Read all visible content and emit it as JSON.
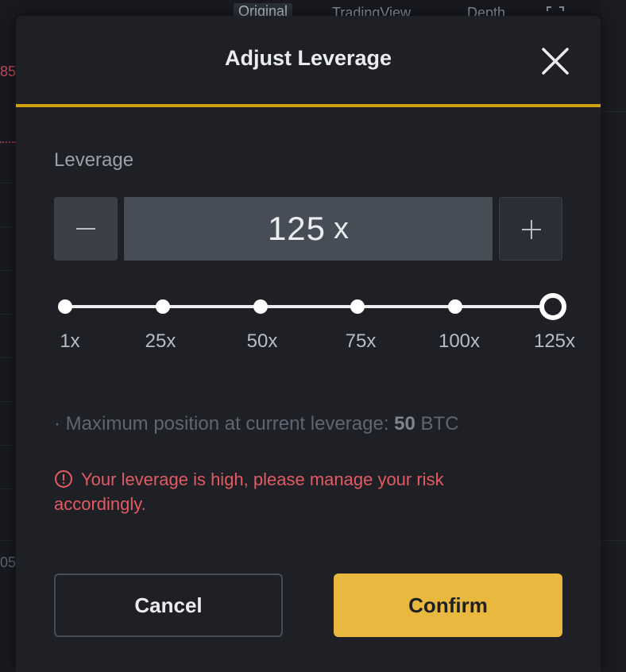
{
  "background": {
    "tabs": [
      "Original",
      "TradingView",
      "Depth"
    ],
    "price_top": "85",
    "price_bottom": "05"
  },
  "modal": {
    "title": "Adjust Leverage",
    "leverage_label": "Leverage",
    "leverage_value": "125",
    "leverage_unit": "x",
    "slider": {
      "marks": [
        "1x",
        "25x",
        "50x",
        "75x",
        "100x",
        "125x"
      ],
      "selected_index": 5
    },
    "max_position": {
      "prefix": "· Maximum position at current leverage: ",
      "amount": "50",
      "unit": " BTC"
    },
    "warning": "Your leverage is high, please manage your risk accordingly.",
    "cancel_label": "Cancel",
    "confirm_label": "Confirm"
  },
  "colors": {
    "accent": "#f0b90b",
    "confirm": "#e8b93e",
    "warning": "#e35a63",
    "modal_bg": "#1e2026"
  },
  "icons": {
    "close": "close-icon",
    "minus": "minus-icon",
    "plus": "plus-icon",
    "warning": "info-circle-icon",
    "expand": "expand-icon"
  }
}
